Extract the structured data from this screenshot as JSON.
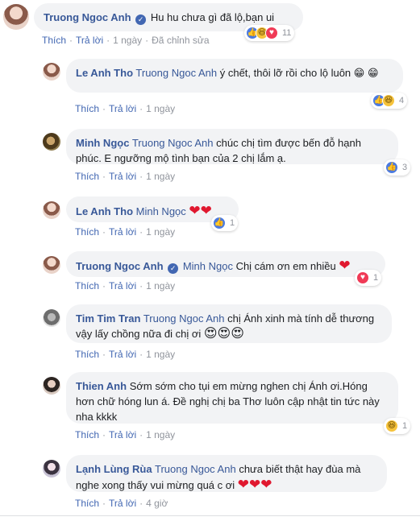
{
  "comments": [
    {
      "author": "Truong Ngoc Anh",
      "verified": true,
      "text": "Hu hu chưa gì đã lộ,bạn ui",
      "actions": [
        "Thích",
        "Trả lời",
        "1 ngày",
        "Đã chỉnh sửa"
      ],
      "reaction_count": "11"
    },
    {
      "author": "Le Anh Tho",
      "mention": "Truong Ngoc Anh",
      "text": " ý chết, thôi lỡ rồi cho lộ luôn 😁 😁",
      "actions": [
        "Thích",
        "Trả lời",
        "1 ngày"
      ],
      "reaction_count": "4"
    },
    {
      "author": "Minh Ngọc",
      "mention": "Truong Ngoc Anh",
      "text": " chúc chị tìm được bến đỗ hạnh phúc. E ngưỡng mộ tình bạn của 2 chị lắm ạ.",
      "actions": [
        "Thích",
        "Trả lời",
        "1 ngày"
      ],
      "reaction_count": "3"
    },
    {
      "author": "Le Anh Tho",
      "mention": "Minh Ngọc",
      "emoji": "❤❤",
      "actions": [
        "Thích",
        "Trả lời",
        "1 ngày"
      ],
      "reaction_count": "1"
    },
    {
      "author": "Truong Ngoc Anh",
      "verified": true,
      "mention": "Minh Ngọc",
      "text": " Chị cám ơn em nhiều ",
      "emoji": "❤",
      "actions": [
        "Thích",
        "Trả lời",
        "1 ngày"
      ],
      "reaction_count": "1"
    },
    {
      "author": "Tim Tim Tran",
      "mention": "Truong Ngoc Anh",
      "text": " chị Ánh xinh mà tính dễ thương vậy lấy chồng nữa đi chị ơi ",
      "emoji": "😍😍😍",
      "actions": [
        "Thích",
        "Trả lời",
        "1 ngày"
      ]
    },
    {
      "author": "Thien Anh",
      "text": " Sớm sớm cho tụi em mừng nghen chị Ánh ơi.Hóng hơn chữ hóng lun á. Đề nghị chị ba Thơ luôn cập nhật tin tức này nha kkkk",
      "actions": [
        "Thích",
        "Trả lời",
        "1 ngày"
      ],
      "reaction_count": "1"
    },
    {
      "author": "Lạnh Lùng Rùa",
      "mention": "Truong Ngoc Anh",
      "text": " chưa biết thật hay đùa mà nghe xong thấy vui mừng quá c ơi ",
      "emoji": "❤❤❤",
      "actions": [
        "Thích",
        "Trả lời",
        "4 giờ"
      ]
    }
  ]
}
